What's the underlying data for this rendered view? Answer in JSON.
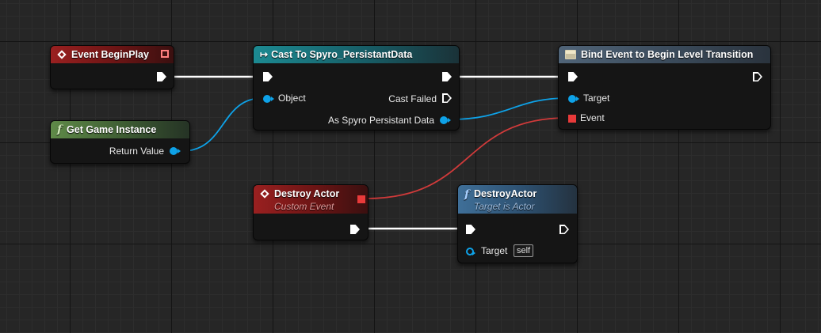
{
  "canvas": {
    "background": "#262626"
  },
  "colors": {
    "exec_wire": "#ffffff",
    "object_wire": "#0ea2e8",
    "delegate_wire": "#d03a3a",
    "event_header": "#9a2020",
    "pure_header": "#5f8a48",
    "cast_header": "#1c8a92",
    "function_header": "#3f6f98"
  },
  "nodes": {
    "begin_play": {
      "title": "Event BeginPlay",
      "icon": "event-diamond-icon"
    },
    "get_game_instance": {
      "title": "Get Game Instance",
      "icon": "function-icon",
      "return_label": "Return Value"
    },
    "cast": {
      "title": "Cast To Spyro_PersistantData",
      "icon": "cast-arrow-icon",
      "object_label": "Object",
      "cast_failed_label": "Cast Failed",
      "as_label": "As Spyro Persistant Data"
    },
    "bind_event": {
      "title": "Bind Event to Begin Level Transition",
      "icon": "bind-event-icon",
      "target_label": "Target",
      "event_label": "Event"
    },
    "destroy_event": {
      "title": "Destroy Actor",
      "subtitle": "Custom Event",
      "icon": "event-diamond-icon"
    },
    "destroy_actor": {
      "title": "DestroyActor",
      "subtitle": "Target is Actor",
      "icon": "function-icon",
      "target_label": "Target",
      "target_default": "self"
    }
  }
}
